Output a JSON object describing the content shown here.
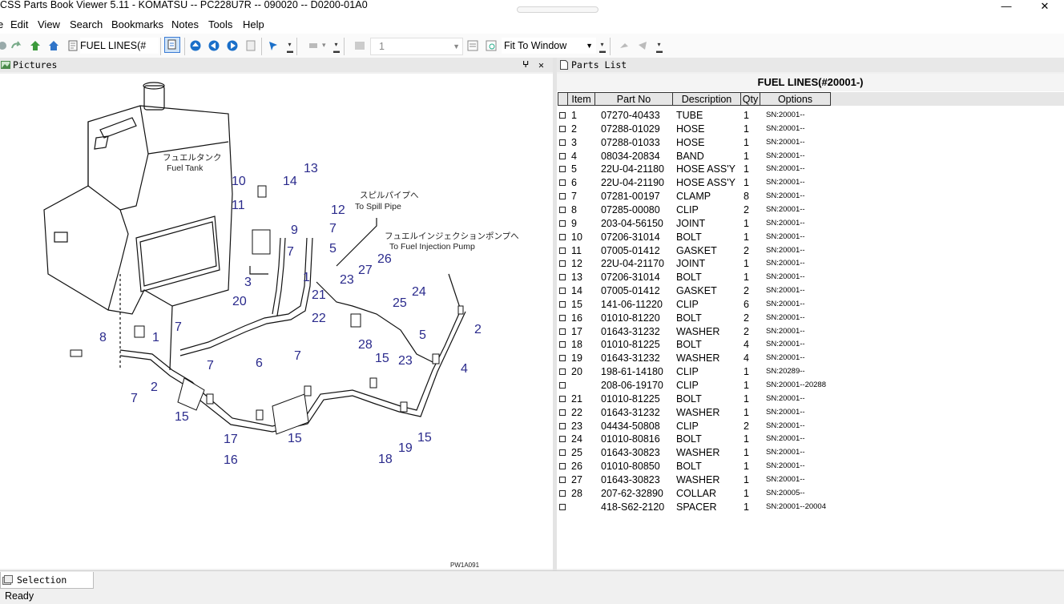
{
  "window": {
    "title": "CSS Parts Book Viewer 5.11 - KOMATSU -- PC228U7R -- 090020 -- D0200-01A0",
    "minimize": "—",
    "close": "✕"
  },
  "menu": {
    "edit": "Edit",
    "view": "View",
    "search": "Search",
    "bookmarks": "Bookmarks",
    "notes": "Notes",
    "tools": "Tools",
    "help": "Help"
  },
  "toolbar": {
    "section_combo": "FUEL LINES(#",
    "page_combo": "1",
    "zoom_combo": "Fit To Window"
  },
  "pictures_pane": {
    "title": "Pictures",
    "pin": "ᵖ",
    "close": "✕",
    "drawing": {
      "fuel_tank_jp": "フュエルタンク",
      "fuel_tank_en": "Fuel Tank",
      "spill_pipe_jp": "スピルパイプへ",
      "spill_pipe_en": "To Spill Pipe",
      "inj_pump_jp": "フュエルインジェクションポンプへ",
      "inj_pump_en": "To Fuel Injection Pump",
      "drawing_code": "PW1A091",
      "callouts": [
        "1",
        "2",
        "3",
        "4",
        "5",
        "6",
        "7",
        "8",
        "9",
        "10",
        "11",
        "12",
        "13",
        "14",
        "15",
        "16",
        "17",
        "18",
        "19",
        "20",
        "21",
        "22",
        "23",
        "24",
        "25",
        "26",
        "27",
        "28"
      ]
    }
  },
  "parts_pane": {
    "title": "Parts List",
    "heading": "FUEL LINES(#20001-)",
    "columns": {
      "item": "Item",
      "part_no": "Part No",
      "description": "Description",
      "qty": "Qty",
      "options": "Options"
    },
    "rows": [
      {
        "item": "1",
        "part": "07270-40433",
        "desc": "TUBE",
        "qty": "1",
        "opt": "SN:20001--"
      },
      {
        "item": "2",
        "part": "07288-01029",
        "desc": "HOSE",
        "qty": "1",
        "opt": "SN:20001--"
      },
      {
        "item": "3",
        "part": "07288-01033",
        "desc": "HOSE",
        "qty": "1",
        "opt": "SN:20001--"
      },
      {
        "item": "4",
        "part": "08034-20834",
        "desc": "BAND",
        "qty": "1",
        "opt": "SN:20001--"
      },
      {
        "item": "5",
        "part": "22U-04-21180",
        "desc": "HOSE ASS'Y",
        "qty": "1",
        "opt": "SN:20001--"
      },
      {
        "item": "6",
        "part": "22U-04-21190",
        "desc": "HOSE ASS'Y",
        "qty": "1",
        "opt": "SN:20001--"
      },
      {
        "item": "7",
        "part": "07281-00197",
        "desc": "CLAMP",
        "qty": "8",
        "opt": "SN:20001--"
      },
      {
        "item": "8",
        "part": "07285-00080",
        "desc": "CLIP",
        "qty": "2",
        "opt": "SN:20001--"
      },
      {
        "item": "9",
        "part": "203-04-56150",
        "desc": "JOINT",
        "qty": "1",
        "opt": "SN:20001--"
      },
      {
        "item": "10",
        "part": "07206-31014",
        "desc": "BOLT",
        "qty": "1",
        "opt": "SN:20001--"
      },
      {
        "item": "11",
        "part": "07005-01412",
        "desc": "GASKET",
        "qty": "2",
        "opt": "SN:20001--"
      },
      {
        "item": "12",
        "part": "22U-04-21170",
        "desc": "JOINT",
        "qty": "1",
        "opt": "SN:20001--"
      },
      {
        "item": "13",
        "part": "07206-31014",
        "desc": "BOLT",
        "qty": "1",
        "opt": "SN:20001--"
      },
      {
        "item": "14",
        "part": "07005-01412",
        "desc": "GASKET",
        "qty": "2",
        "opt": "SN:20001--"
      },
      {
        "item": "15",
        "part": "141-06-11220",
        "desc": "CLIP",
        "qty": "6",
        "opt": "SN:20001--"
      },
      {
        "item": "16",
        "part": "01010-81220",
        "desc": "BOLT",
        "qty": "2",
        "opt": "SN:20001--"
      },
      {
        "item": "17",
        "part": "01643-31232",
        "desc": "WASHER",
        "qty": "2",
        "opt": "SN:20001--"
      },
      {
        "item": "18",
        "part": "01010-81225",
        "desc": "BOLT",
        "qty": "4",
        "opt": "SN:20001--"
      },
      {
        "item": "19",
        "part": "01643-31232",
        "desc": "WASHER",
        "qty": "4",
        "opt": "SN:20001--"
      },
      {
        "item": "20",
        "part": "198-61-14180",
        "desc": "CLIP",
        "qty": "1",
        "opt": "SN:20289--"
      },
      {
        "item": "",
        "part": "208-06-19170",
        "desc": "CLIP",
        "qty": "1",
        "opt": "SN:20001--20288"
      },
      {
        "item": "21",
        "part": "01010-81225",
        "desc": "BOLT",
        "qty": "1",
        "opt": "SN:20001--"
      },
      {
        "item": "22",
        "part": "01643-31232",
        "desc": "WASHER",
        "qty": "1",
        "opt": "SN:20001--"
      },
      {
        "item": "23",
        "part": "04434-50808",
        "desc": "CLIP",
        "qty": "2",
        "opt": "SN:20001--"
      },
      {
        "item": "24",
        "part": "01010-80816",
        "desc": "BOLT",
        "qty": "1",
        "opt": "SN:20001--"
      },
      {
        "item": "25",
        "part": "01643-30823",
        "desc": "WASHER",
        "qty": "1",
        "opt": "SN:20001--"
      },
      {
        "item": "26",
        "part": "01010-80850",
        "desc": "BOLT",
        "qty": "1",
        "opt": "SN:20001--"
      },
      {
        "item": "27",
        "part": "01643-30823",
        "desc": "WASHER",
        "qty": "1",
        "opt": "SN:20001--"
      },
      {
        "item": "28",
        "part": "207-62-32890",
        "desc": "COLLAR",
        "qty": "1",
        "opt": "SN:20005--"
      },
      {
        "item": "",
        "part": "418-S62-2120",
        "desc": "SPACER",
        "qty": "1",
        "opt": "SN:20001--20004"
      }
    ]
  },
  "bottom": {
    "selection_tab": "Selection List"
  },
  "status": {
    "text": "Ready"
  },
  "colors": {
    "callout": "#2a2a8c",
    "line": "#111111",
    "accent_blue": "#1a6fc9"
  }
}
